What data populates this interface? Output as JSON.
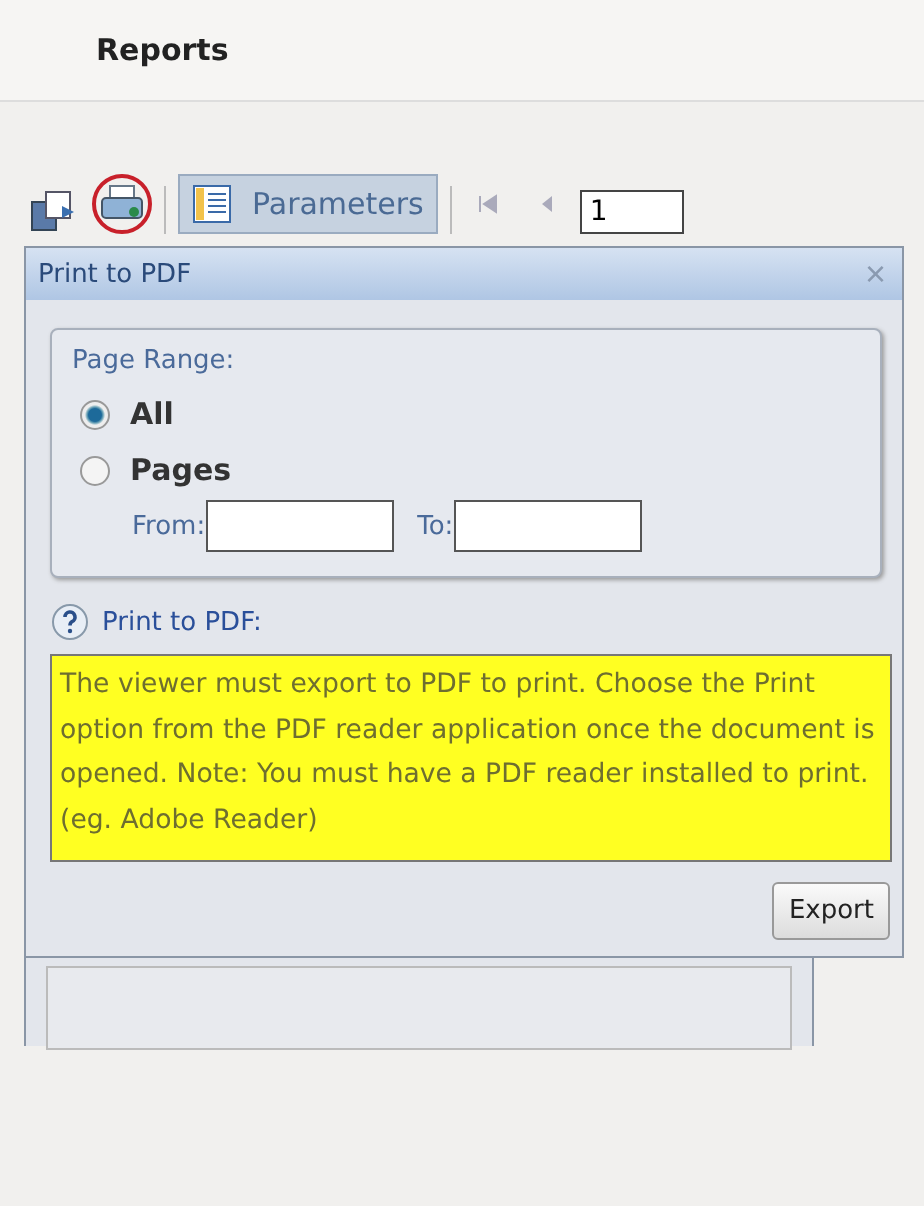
{
  "header": {
    "title": "Reports"
  },
  "toolbar": {
    "parameters_button": {
      "label": "Parameters",
      "pressed": true
    },
    "page_input": {
      "value": "1"
    }
  },
  "dialog": {
    "title": "Print to PDF",
    "close": "×",
    "page_range": {
      "legend": "Page Range:",
      "options": [
        {
          "label": "All",
          "selected": true
        },
        {
          "label": "Pages",
          "selected": false
        }
      ],
      "from_label": "From:",
      "to_label": "To:"
    },
    "help_title": "Print to PDF:",
    "help_text": "The viewer must export to PDF to print. Choose the Print option from the PDF reader application once the document is opened. Note: You must have a PDF reader installed to print. (eg. Adobe Reader)",
    "export_button": "Export"
  }
}
